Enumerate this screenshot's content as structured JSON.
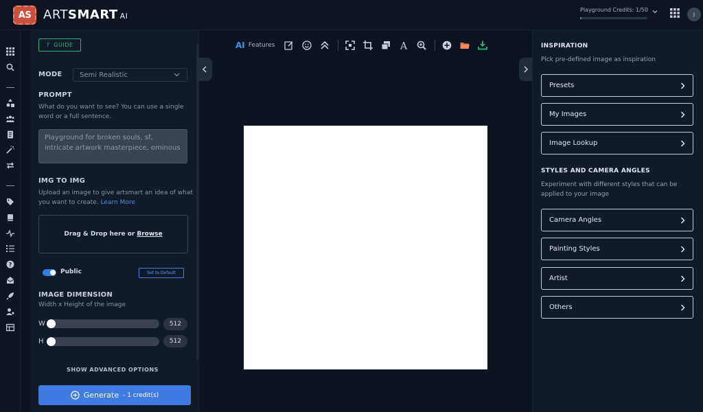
{
  "app": {
    "logo_badge": "AS",
    "logo_art": "ART",
    "logo_smart": "SMART",
    "logo_ai": "AI"
  },
  "header": {
    "credits_label": "Playground Credits: 1/50",
    "credits_fraction": 0.02,
    "avatar_initial": "J",
    "accent_green": "#28b67a"
  },
  "rail_icons": [
    "apps-icon",
    "search-icon",
    "shapes-icon",
    "users-icon",
    "document-icon",
    "magic-wand-icon",
    "swap-icon",
    "tag-icon",
    "book-icon",
    "activity-icon",
    "list-icon",
    "help-icon",
    "mail-icon",
    "rocket-icon",
    "user-settings-icon",
    "table-icon"
  ],
  "left": {
    "guide_label": "GUIDE",
    "mode_label": "MODE",
    "mode_value": "Semi Realistic",
    "prompt_label": "PROMPT",
    "prompt_hint": "What do you want to see? You can use a single word or a full sentence.",
    "prompt_value": "Playground for broken souls, sf, intricate artwork masterpiece, ominous",
    "img2img_label": "IMG TO IMG",
    "img2img_hint": "Upload an image to give artsmart an idea of what you want to create.",
    "learn_more": "Learn More",
    "drop_text": "Drag & Drop here or",
    "browse": "Browse",
    "public_label": "Public",
    "set_default": "Set to Default",
    "dimension_label": "IMAGE DIMENSION",
    "dimension_hint": "Width x Height of the image",
    "width_label": "W",
    "width_value": "512",
    "height_label": "H",
    "height_value": "512",
    "advanced": "SHOW ADVANCED OPTIONS",
    "generate_label": "Generate",
    "generate_credits": "- 1 credit(s)",
    "accent_blue": "#3f7be0"
  },
  "toolbar": {
    "ai_tag": "AI",
    "features_label": "Features",
    "icons": [
      "edit-icon",
      "smile-icon",
      "upscale-icon",
      "expand-icon",
      "crop-icon",
      "layers-icon",
      "text-icon",
      "zoom-icon",
      "add-circle-icon",
      "folder-icon",
      "download-icon"
    ]
  },
  "right": {
    "inspiration_title": "INSPIRATION",
    "inspiration_hint": "Pick pre-defined image as inspiration",
    "inspiration_items": [
      "Presets",
      "My Images",
      "Image Lookup"
    ],
    "styles_title": "STYLES AND CAMERA ANGLES",
    "styles_hint": "Experiment with different styles that can be applied to your image",
    "style_items": [
      "Camera Angles",
      "Painting Styles",
      "Artist",
      "Others"
    ]
  }
}
